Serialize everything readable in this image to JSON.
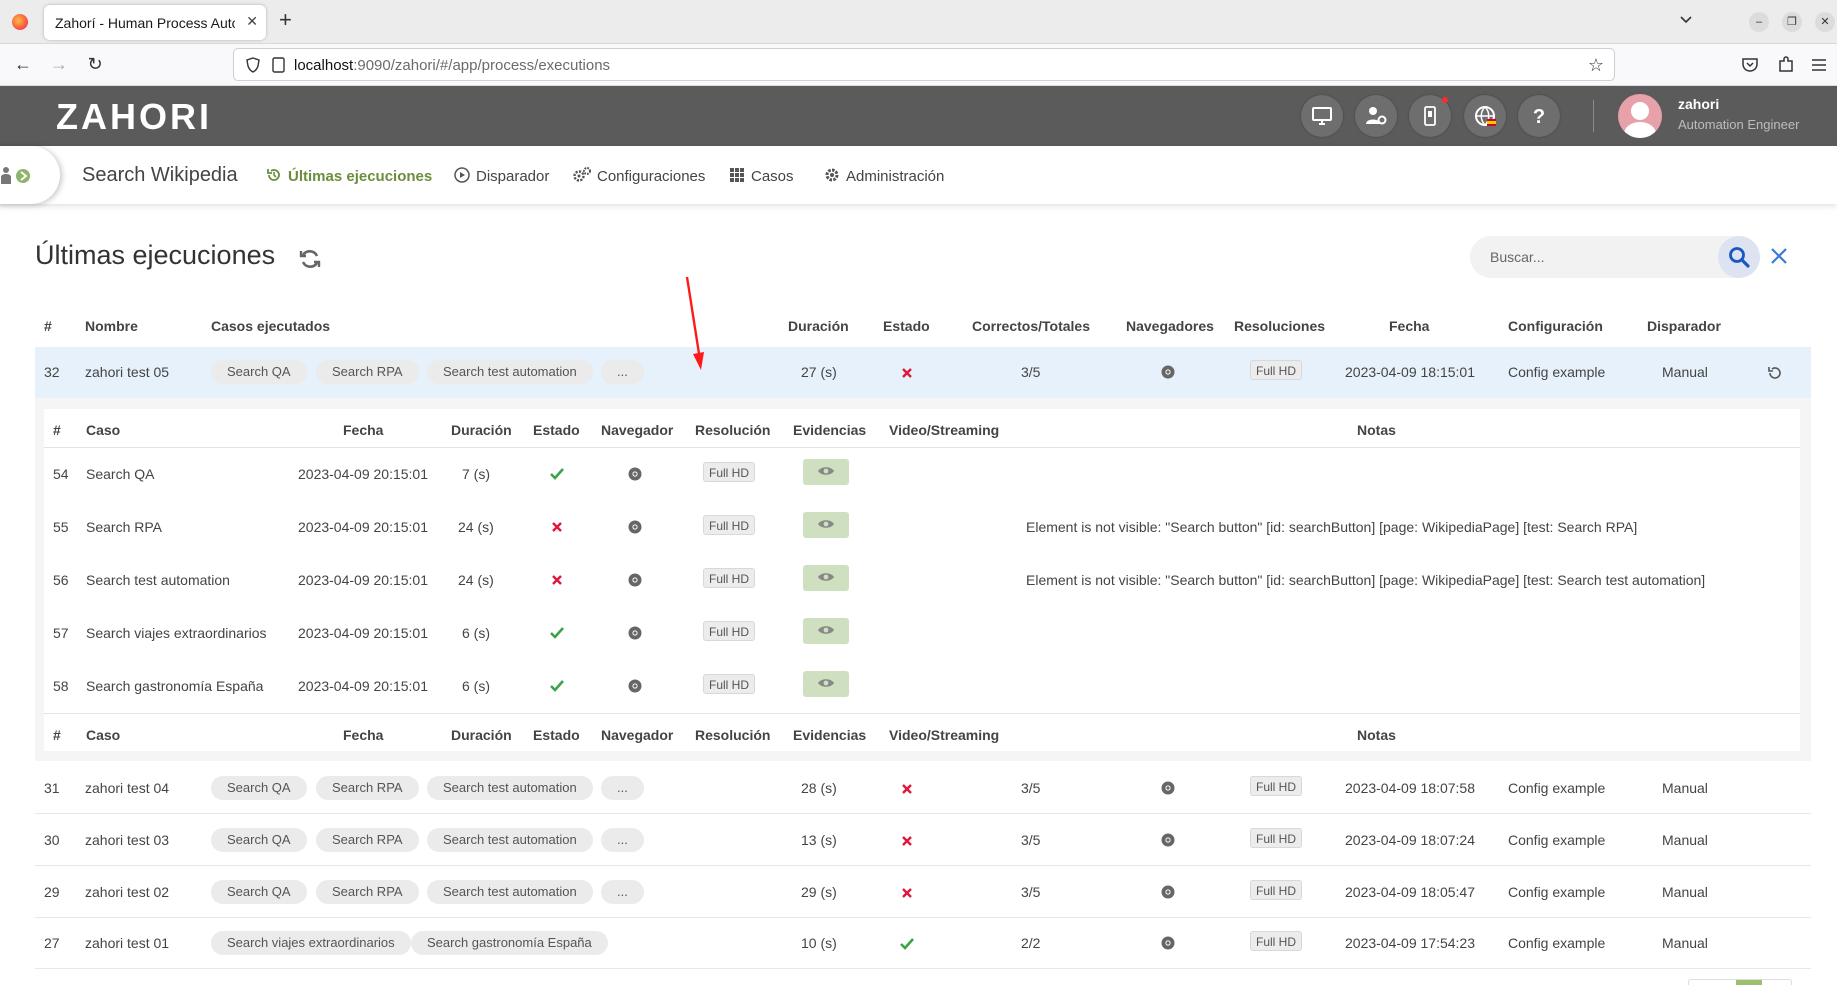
{
  "browser": {
    "tab_title": "Zahorí - Human Process Auto",
    "url_host": "localhost",
    "url_rest": ":9090/zahori/#/app/process/executions"
  },
  "app": {
    "logo": "ZAHORI",
    "user": {
      "name": "zahori",
      "role": "Automation Engineer"
    },
    "header_icons": [
      "monitor-icon",
      "user-gear-icon",
      "mobile-icon",
      "globe-language-icon",
      "help-icon"
    ]
  },
  "process": {
    "name": "Search Wikipedia",
    "menu": [
      {
        "label": "Últimas ejecuciones",
        "icon": "history-icon",
        "active": true
      },
      {
        "label": "Disparador",
        "icon": "play-icon",
        "active": false
      },
      {
        "label": "Configuraciones",
        "icon": "gears-icon",
        "active": false
      },
      {
        "label": "Casos",
        "icon": "grid-icon",
        "active": false
      },
      {
        "label": "Administración",
        "icon": "gear-icon",
        "active": false
      }
    ]
  },
  "page": {
    "title": "Últimas ejecuciones",
    "search_placeholder": "Buscar..."
  },
  "executions_table": {
    "headers": [
      "#",
      "Nombre",
      "Casos ejecutados",
      "Duración",
      "Estado",
      "Correctos/Totales",
      "Navegadores",
      "Resoluciones",
      "Fecha",
      "Configuración",
      "Disparador"
    ],
    "rows": [
      {
        "id": "32",
        "name": "zahori test 05",
        "cases": [
          "Search QA",
          "Search RPA",
          "Search test automation",
          "..."
        ],
        "duration": "27 (s)",
        "status": "fail",
        "ratio": "3/5",
        "browser": "chrome-icon",
        "resolution": "Full HD",
        "date": "2023-04-09 18:15:01",
        "config": "Config example",
        "trigger": "Manual",
        "expanded": true
      },
      {
        "id": "31",
        "name": "zahori test 04",
        "cases": [
          "Search QA",
          "Search RPA",
          "Search test automation",
          "..."
        ],
        "duration": "28 (s)",
        "status": "fail",
        "ratio": "3/5",
        "browser": "chrome-icon",
        "resolution": "Full HD",
        "date": "2023-04-09 18:07:58",
        "config": "Config example",
        "trigger": "Manual"
      },
      {
        "id": "30",
        "name": "zahori test 03",
        "cases": [
          "Search QA",
          "Search RPA",
          "Search test automation",
          "..."
        ],
        "duration": "13 (s)",
        "status": "fail",
        "ratio": "3/5",
        "browser": "chrome-icon",
        "resolution": "Full HD",
        "date": "2023-04-09 18:07:24",
        "config": "Config example",
        "trigger": "Manual"
      },
      {
        "id": "29",
        "name": "zahori test 02",
        "cases": [
          "Search QA",
          "Search RPA",
          "Search test automation",
          "..."
        ],
        "duration": "29 (s)",
        "status": "fail",
        "ratio": "3/5",
        "browser": "chrome-icon",
        "resolution": "Full HD",
        "date": "2023-04-09 18:05:47",
        "config": "Config example",
        "trigger": "Manual"
      },
      {
        "id": "27",
        "name": "zahori test 01",
        "cases": [
          "Search viajes extraordinarios",
          "Search gastronomía España"
        ],
        "duration": "10 (s)",
        "status": "pass",
        "ratio": "2/2",
        "browser": "chrome-icon",
        "resolution": "Full HD",
        "date": "2023-04-09 17:54:23",
        "config": "Config example",
        "trigger": "Manual"
      }
    ]
  },
  "cases_table": {
    "headers": [
      "#",
      "Caso",
      "Fecha",
      "Duración",
      "Estado",
      "Navegador",
      "Resolución",
      "Evidencias",
      "Video/Streaming",
      "Notas"
    ],
    "rows": [
      {
        "id": "54",
        "case": "Search QA",
        "date": "2023-04-09 20:15:01",
        "duration": "7 (s)",
        "status": "pass",
        "browser": "chrome-icon",
        "resolution": "Full HD",
        "notes": ""
      },
      {
        "id": "55",
        "case": "Search RPA",
        "date": "2023-04-09 20:15:01",
        "duration": "24 (s)",
        "status": "fail",
        "browser": "chrome-icon",
        "resolution": "Full HD",
        "notes": "Element is not visible: \"Search button\" [id: searchButton] [page: WikipediaPage] [test: Search RPA]"
      },
      {
        "id": "56",
        "case": "Search test automation",
        "date": "2023-04-09 20:15:01",
        "duration": "24 (s)",
        "status": "fail",
        "browser": "chrome-icon",
        "resolution": "Full HD",
        "notes": "Element is not visible: \"Search button\" [id: searchButton] [page: WikipediaPage] [test: Search test automation]"
      },
      {
        "id": "57",
        "case": "Search viajes extraordinarios",
        "date": "2023-04-09 20:15:01",
        "duration": "6 (s)",
        "status": "pass",
        "browser": "chrome-icon",
        "resolution": "Full HD",
        "notes": ""
      },
      {
        "id": "58",
        "case": "Search gastronomía España",
        "date": "2023-04-09 20:15:01",
        "duration": "6 (s)",
        "status": "pass",
        "browser": "chrome-icon",
        "resolution": "Full HD",
        "notes": ""
      }
    ]
  },
  "colors": {
    "header_bg": "#5b5b5b",
    "accent_green": "#6c8d3e",
    "pass": "#3aa34a",
    "fail": "#e0163c",
    "selected_row": "#e6f1fb"
  }
}
